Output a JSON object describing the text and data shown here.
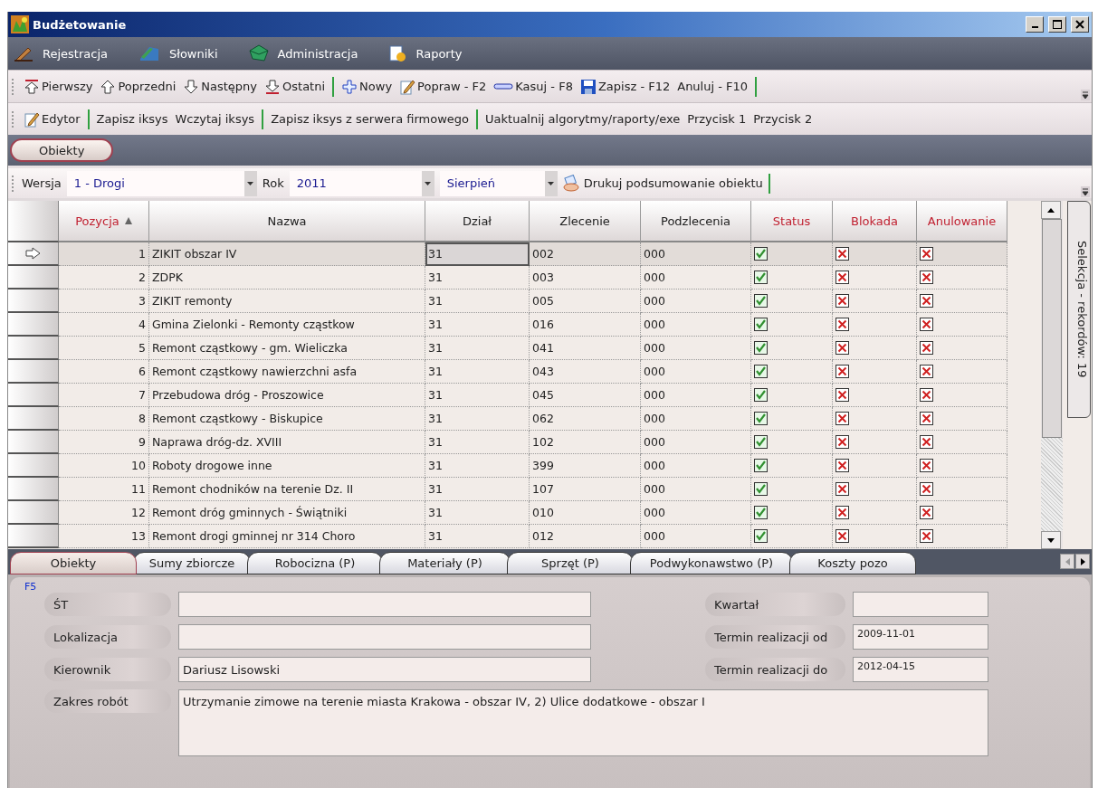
{
  "window": {
    "title": "Budżetowanie"
  },
  "menu": [
    {
      "label": "Rejestracja"
    },
    {
      "label": "Słowniki"
    },
    {
      "label": "Administracja"
    },
    {
      "label": "Raporty"
    }
  ],
  "toolbars": [
    {
      "items": [
        {
          "kind": "icon-button",
          "label": "Pierwszy"
        },
        {
          "kind": "icon-button",
          "label": "Poprzedni"
        },
        {
          "kind": "icon-button",
          "label": "Następny"
        },
        {
          "kind": "icon-button",
          "label": "Ostatni"
        },
        {
          "kind": "separator"
        },
        {
          "kind": "icon-button",
          "label": "Nowy"
        },
        {
          "kind": "icon-button",
          "label": "Popraw - F2"
        },
        {
          "kind": "icon-button",
          "label": "Kasuj - F8"
        },
        {
          "kind": "icon-button",
          "label": "Zapisz - F12"
        },
        {
          "kind": "text-button",
          "label": "Anuluj - F10"
        },
        {
          "kind": "separator"
        }
      ]
    },
    {
      "items": [
        {
          "kind": "icon-button",
          "label": "Edytor"
        },
        {
          "kind": "separator"
        },
        {
          "kind": "text-button",
          "label": "Zapisz iksys"
        },
        {
          "kind": "text-button",
          "label": "Wczytaj iksys"
        },
        {
          "kind": "separator"
        },
        {
          "kind": "text-button",
          "label": "Zapisz iksys z serwera firmowego"
        },
        {
          "kind": "separator"
        },
        {
          "kind": "text-button",
          "label": "Uaktualnij algorytmy/raporty/exe"
        },
        {
          "kind": "text-button",
          "label": "Przycisk 1"
        },
        {
          "kind": "text-button",
          "label": "Przycisk 2"
        }
      ]
    }
  ],
  "module_tabs": [
    {
      "label": "Obiekty",
      "selected": true
    }
  ],
  "filter_bar": {
    "version_label": "Wersja",
    "version": "1 - Drogi",
    "year_label": "Rok",
    "year": "2011",
    "month": "Sierpień",
    "print_button": "Drukuj podsumowanie obiektu"
  },
  "table": {
    "columns": [
      {
        "label": "Pozycja",
        "sorted": true,
        "color": "#c02030"
      },
      {
        "label": "Nazwa",
        "sorted": false,
        "color": "#202020"
      },
      {
        "label": "Dział",
        "sorted": false,
        "color": "#202020"
      },
      {
        "label": "Zlecenie",
        "sorted": false,
        "color": "#202020"
      },
      {
        "label": "Podzlecenia",
        "sorted": false,
        "color": "#202020"
      },
      {
        "label": "Status",
        "sorted": false,
        "color": "#c02030"
      },
      {
        "label": "Blokada",
        "sorted": false,
        "color": "#c02030"
      },
      {
        "label": "Anulowanie",
        "sorted": false,
        "color": "#c02030"
      }
    ],
    "rows": [
      {
        "selected": true,
        "pozycja": "1",
        "nazwa": "ZIKIT obszar IV",
        "dzial": "31",
        "zlecenie": "002",
        "podzlecenia": "000",
        "status": true,
        "blokada": false,
        "anulowanie": false
      },
      {
        "selected": false,
        "pozycja": "2",
        "nazwa": "ZDPK",
        "dzial": "31",
        "zlecenie": "003",
        "podzlecenia": "000",
        "status": true,
        "blokada": false,
        "anulowanie": false
      },
      {
        "selected": false,
        "pozycja": "3",
        "nazwa": "ZIKIT remonty",
        "dzial": "31",
        "zlecenie": "005",
        "podzlecenia": "000",
        "status": true,
        "blokada": false,
        "anulowanie": false
      },
      {
        "selected": false,
        "pozycja": "4",
        "nazwa": "Gmina Zielonki - Remonty cząstkow",
        "dzial": "31",
        "zlecenie": "016",
        "podzlecenia": "000",
        "status": true,
        "blokada": false,
        "anulowanie": false
      },
      {
        "selected": false,
        "pozycja": "5",
        "nazwa": "Remont cząstkowy - gm. Wieliczka",
        "dzial": "31",
        "zlecenie": "041",
        "podzlecenia": "000",
        "status": true,
        "blokada": false,
        "anulowanie": false
      },
      {
        "selected": false,
        "pozycja": "6",
        "nazwa": "Remont cząstkowy nawierzchni asfa",
        "dzial": "31",
        "zlecenie": "043",
        "podzlecenia": "000",
        "status": true,
        "blokada": false,
        "anulowanie": false
      },
      {
        "selected": false,
        "pozycja": "7",
        "nazwa": "Przebudowa dróg - Proszowice",
        "dzial": "31",
        "zlecenie": "045",
        "podzlecenia": "000",
        "status": true,
        "blokada": false,
        "anulowanie": false
      },
      {
        "selected": false,
        "pozycja": "8",
        "nazwa": "Remont cząstkowy - Biskupice",
        "dzial": "31",
        "zlecenie": "062",
        "podzlecenia": "000",
        "status": true,
        "blokada": false,
        "anulowanie": false
      },
      {
        "selected": false,
        "pozycja": "9",
        "nazwa": "Naprawa dróg-dz. XVIII",
        "dzial": "31",
        "zlecenie": "102",
        "podzlecenia": "000",
        "status": true,
        "blokada": false,
        "anulowanie": false
      },
      {
        "selected": false,
        "pozycja": "10",
        "nazwa": "Roboty drogowe inne",
        "dzial": "31",
        "zlecenie": "399",
        "podzlecenia": "000",
        "status": true,
        "blokada": false,
        "anulowanie": false
      },
      {
        "selected": false,
        "pozycja": "11",
        "nazwa": "Remont chodników na terenie Dz. II",
        "dzial": "31",
        "zlecenie": "107",
        "podzlecenia": "000",
        "status": true,
        "blokada": false,
        "anulowanie": false
      },
      {
        "selected": false,
        "pozycja": "12",
        "nazwa": "Remont dróg gminnych - Świątniki",
        "dzial": "31",
        "zlecenie": "010",
        "podzlecenia": "000",
        "status": true,
        "blokada": false,
        "anulowanie": false
      },
      {
        "selected": false,
        "pozycja": "13",
        "nazwa": "Remont drogi gminnej nr 314 Choro",
        "dzial": "31",
        "zlecenie": "012",
        "podzlecenia": "000",
        "status": true,
        "blokada": false,
        "anulowanie": false
      }
    ],
    "side_tab": "Selekcja - rekordów: 19"
  },
  "detail_tabs": [
    {
      "label": "Obiekty",
      "selected": true
    },
    {
      "label": "Sumy zbiorcze",
      "selected": false
    },
    {
      "label": "Robocizna (P)",
      "selected": false
    },
    {
      "label": "Materiały (P)",
      "selected": false
    },
    {
      "label": "Sprzęt (P)",
      "selected": false
    },
    {
      "label": "Podwykonawstwo (P)",
      "selected": false
    },
    {
      "label": "Koszty pozo",
      "selected": false
    }
  ],
  "form": {
    "hotkey": "F5",
    "left_fields": [
      {
        "label": "ŚT"
      },
      {
        "label": "Lokalizacja"
      },
      {
        "label": "Kierownik",
        "value": "Dariusz Lisowski"
      }
    ],
    "right_fields": [
      {
        "label": "Kwartał"
      },
      {
        "label": "Termin realizacji od",
        "value": "2009-11-01"
      },
      {
        "label": "Termin realizacji do",
        "value": "2012-04-15"
      }
    ],
    "scope": {
      "label": "Zakres robót",
      "value": "Utrzymanie zimowe na terenie miasta Krakowa - obszar IV, 2) Ulice dodatkowe - obszar I"
    }
  }
}
